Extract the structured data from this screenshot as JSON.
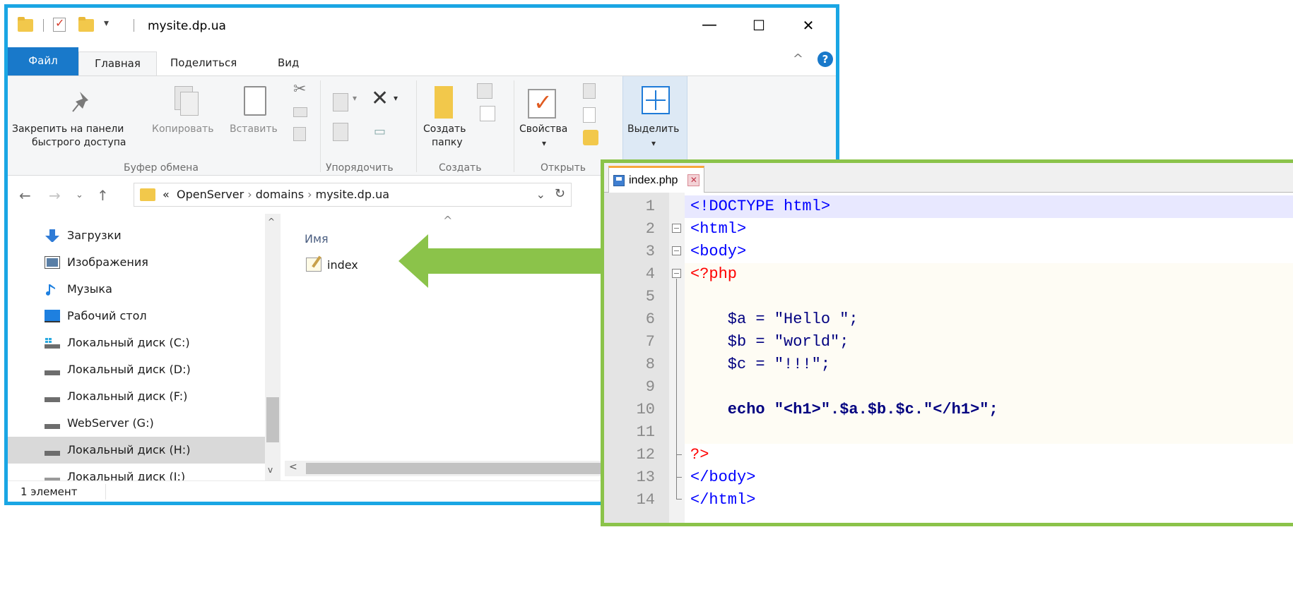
{
  "explorer": {
    "title": "mysite.dp.ua",
    "window_controls": {
      "minimize": "—",
      "maximize": "☐",
      "close": "✕"
    },
    "tabs": [
      "Файл",
      "Главная",
      "Поделиться",
      "Вид"
    ],
    "ribbon": {
      "pin_label_1": "Закрепить на панели",
      "pin_label_2": "быстрого доступа",
      "copy_label": "Копировать",
      "paste_label": "Вставить",
      "new_folder_label_1": "Создать",
      "new_folder_label_2": "папку",
      "properties_label": "Свойства",
      "select_label": "Выделить",
      "groups": [
        "Буфер обмена",
        "Упорядочить",
        "Создать",
        "Открыть"
      ]
    },
    "address": {
      "prefix": "«",
      "segments": [
        "OpenServer",
        "domains",
        "mysite.dp.ua"
      ],
      "separator": "›"
    },
    "sidebar": [
      {
        "label": "Загрузки",
        "icon": "download-icon"
      },
      {
        "label": "Изображения",
        "icon": "pictures-icon"
      },
      {
        "label": "Музыка",
        "icon": "music-icon"
      },
      {
        "label": "Рабочий стол",
        "icon": "desktop-icon"
      },
      {
        "label": "Локальный диск (C:)",
        "icon": "system-drive-icon"
      },
      {
        "label": "Локальный диск (D:)",
        "icon": "drive-icon"
      },
      {
        "label": "Локальный диск (F:)",
        "icon": "drive-icon"
      },
      {
        "label": "WebServer (G:)",
        "icon": "drive-icon"
      },
      {
        "label": "Локальный диск (H:)",
        "icon": "drive-icon",
        "selected": true
      },
      {
        "label": "Локальный диск (I:)",
        "icon": "drive-icon"
      }
    ],
    "column_header": "Имя",
    "files": [
      {
        "name": "index"
      }
    ],
    "status": "1 элемент"
  },
  "editor": {
    "tab_label": "index.php",
    "lines": [
      "<!DOCTYPE html>",
      "<html>",
      "<body>",
      "<?php",
      "",
      "    $a = \"Hello \";",
      "    $b = \"world\";",
      "    $c = \"!!!\";",
      "",
      "    echo \"<h1>\".$a.$b.$c.\"</h1>\";",
      "",
      "?>",
      "</body>",
      "</html>"
    ],
    "line_numbers": [
      "1",
      "2",
      "3",
      "4",
      "5",
      "6",
      "7",
      "8",
      "9",
      "10",
      "11",
      "12",
      "13",
      "14"
    ]
  },
  "colors": {
    "explorer_border": "#1aa6e4",
    "editor_border": "#8bc34a",
    "arrow": "#8bc34a",
    "file_tab": "#1979ca"
  }
}
